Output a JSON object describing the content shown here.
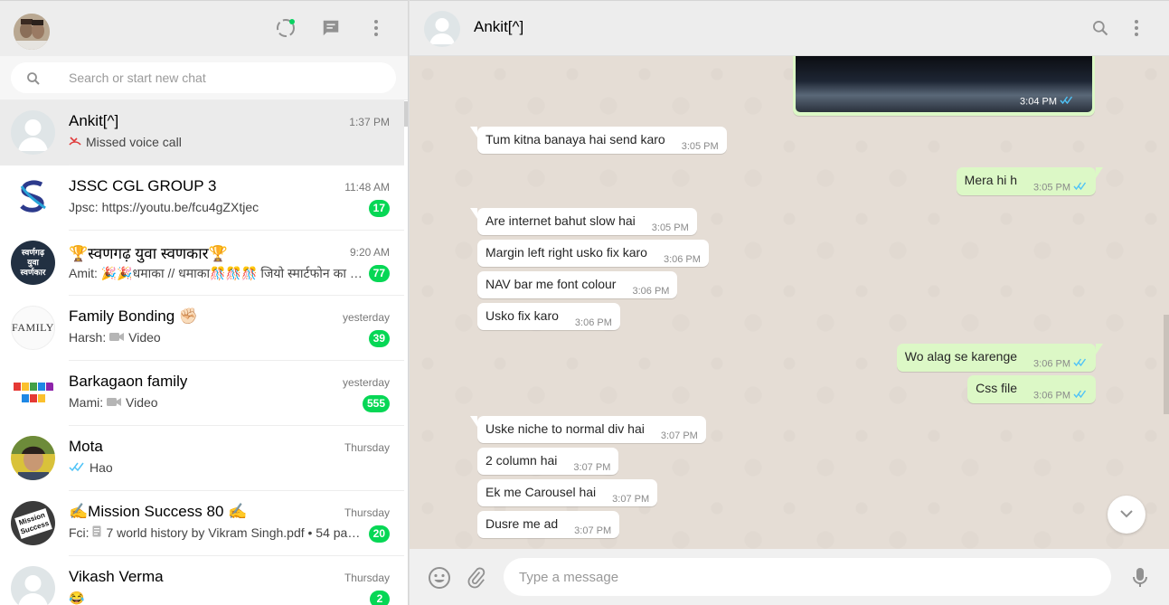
{
  "sidebar": {
    "search_placeholder": "Search or start new chat",
    "chats": [
      {
        "name": "Ankit[^]",
        "time": "1:37 PM",
        "preview": "Missed voice call",
        "badge": "",
        "active": true
      },
      {
        "name": "JSSC CGL GROUP 3",
        "time": "11:48 AM",
        "preview": "Jpsc: https://youtu.be/fcu4gZXtjec",
        "badge": "17"
      },
      {
        "name": "🏆स्वणगढ़ युवा स्वणकार🏆",
        "time": "9:20 AM",
        "preview": "Amit: 🎉🎉धमाका // धमाका🎊🎊🎊 जियो स्मार्टफोन का …",
        "badge": "77",
        "avatar_text": "स्वर्णगढ़ युवा स्वर्णकार"
      },
      {
        "name": "Family Bonding ✊🏻",
        "time": "yesterday",
        "preview_prefix": "Harsh: ",
        "preview": "Video",
        "badge": "39",
        "avatar_text": "FAMILY"
      },
      {
        "name": "Barkagaon family",
        "time": "yesterday",
        "preview_prefix": "Mami: ",
        "preview": "Video",
        "badge": "555"
      },
      {
        "name": "Mota",
        "time": "Thursday",
        "preview": "Hao",
        "badge": ""
      },
      {
        "name": "✍Mission Success 80 ✍",
        "time": "Thursday",
        "preview_prefix": "Fci: ",
        "preview": "7 world history by Vikram Singh.pdf • 54 pa…",
        "badge": "20",
        "avatar_text": "Mission Success"
      },
      {
        "name": "Vikash Verma",
        "time": "Thursday",
        "preview": "😂",
        "badge": "2"
      }
    ]
  },
  "conversation": {
    "contact_name": "Ankit[^]",
    "image_time": "3:04 PM",
    "messages": [
      {
        "dir": "in",
        "text": "Tum kitna banaya hai send karo",
        "time": "3:05 PM"
      },
      {
        "dir": "out",
        "text": "Mera hi h",
        "time": "3:05 PM"
      },
      {
        "dir": "in",
        "text": "Are internet bahut slow hai",
        "time": "3:05 PM"
      },
      {
        "dir": "in",
        "text": "Margin left right usko fix karo",
        "time": "3:06 PM"
      },
      {
        "dir": "in",
        "text": "NAV bar me font colour",
        "time": "3:06 PM"
      },
      {
        "dir": "in",
        "text": "Usko fix karo",
        "time": "3:06 PM"
      },
      {
        "dir": "out",
        "text": "Wo alag se karenge",
        "time": "3:06 PM"
      },
      {
        "dir": "out",
        "text": "Css file",
        "time": "3:06 PM"
      },
      {
        "dir": "in",
        "text": "Uske niche to normal div hai",
        "time": "3:07 PM"
      },
      {
        "dir": "in",
        "text": "2 column hai",
        "time": "3:07 PM"
      },
      {
        "dir": "in",
        "text": "Ek me Carousel hai",
        "time": "3:07 PM"
      },
      {
        "dir": "in",
        "text": "Dusre me ad",
        "time": "3:07 PM"
      }
    ],
    "composer_placeholder": "Type a message"
  },
  "colors": {
    "badge": "#06d755",
    "outgoing_bubble": "#dcf8c6",
    "read_tick": "#4fc3f7",
    "missed_call": "#e03b3b"
  }
}
